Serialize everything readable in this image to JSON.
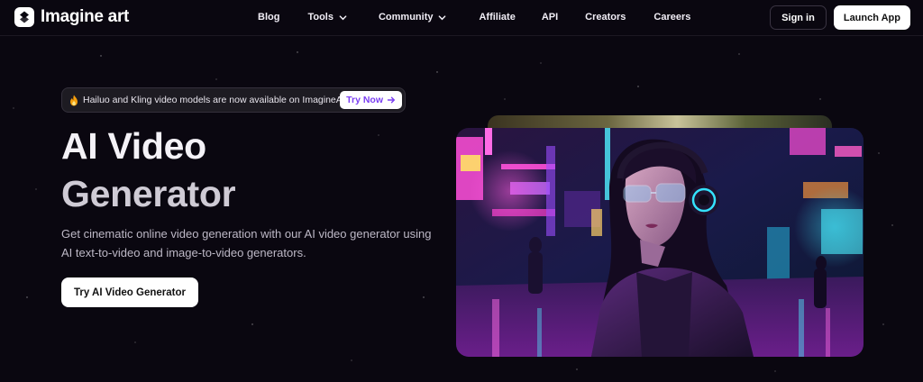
{
  "brand": {
    "name": "Imagine art",
    "logo_icon": "imagine-art-logo"
  },
  "nav": {
    "links": [
      {
        "label": "Blog"
      },
      {
        "label": "Tools",
        "icon": "chevron-down-icon"
      },
      {
        "label": "Community",
        "icon": "chevron-down-icon"
      },
      {
        "label": "Affiliate"
      },
      {
        "label": "API"
      },
      {
        "label": "Creators"
      },
      {
        "label": "Careers"
      }
    ],
    "signin_label": "Sign in",
    "launch_label": "Launch App"
  },
  "announcement": {
    "icon": "fire-icon",
    "text": "Hailuo and Kling video models are now available on ImagineArt",
    "cta_label": "Try Now",
    "cta_icon": "arrow-right-icon",
    "cta_color": "#7b3ff2"
  },
  "hero": {
    "title_line1": "AI Video",
    "title_line2": "Generator",
    "subtitle": "Get cinematic online video generation with our AI video generator using AI text-to-video and image-to-video generators.",
    "cta_label": "Try AI Video Generator",
    "image_alt": "Cyberpunk woman with headphones on neon city street"
  },
  "colors": {
    "background": "#0a0710",
    "neon_pink": "#e040fb",
    "neon_cyan": "#22d3ee"
  }
}
